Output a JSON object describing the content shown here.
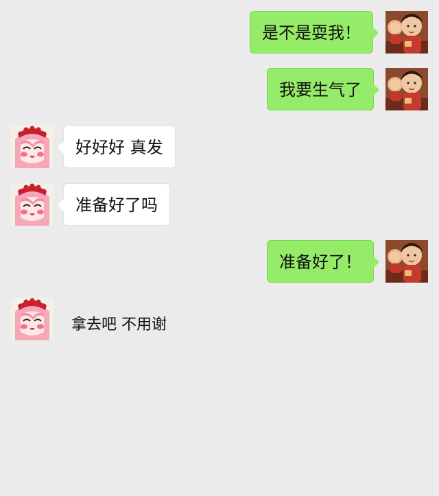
{
  "colors": {
    "background": "#ebebeb",
    "outgoing_bubble": "#95ec69",
    "incoming_bubble": "#ffffff"
  },
  "messages": [
    {
      "side": "outgoing",
      "text": "是不是耍我！"
    },
    {
      "side": "outgoing",
      "text": "我要生气了"
    },
    {
      "side": "incoming",
      "text": "好好好 真发"
    },
    {
      "side": "incoming",
      "text": "准备好了吗"
    },
    {
      "side": "outgoing",
      "text": "准备好了！"
    },
    {
      "side": "incoming",
      "text": "拿去吧  不用谢",
      "style": "sticker-caption"
    }
  ]
}
